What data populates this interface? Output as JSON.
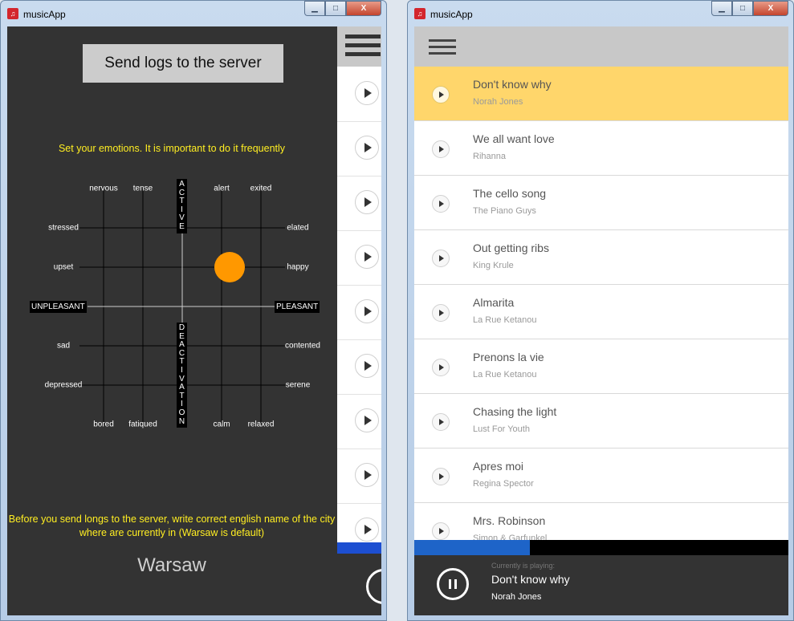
{
  "app_title": "musicApp",
  "window_buttons": {
    "minimize": "▁",
    "maximize": "□",
    "close": "X"
  },
  "emotion_panel": {
    "send_logs_label": "Send logs to the server",
    "instruction": "Set your emotions. It is important to do it frequently",
    "axis": {
      "active": "A\nC\nT\nI\nV\nE",
      "deactivation": "D\nE\nA\nC\nT\nI\nV\nA\nT\nI\nO\nN",
      "unpleasant": "UNPLEASANT",
      "pleasant": "PLEASANT"
    },
    "emotions": [
      "nervous",
      "tense",
      "alert",
      "exited",
      "stressed",
      "elated",
      "upset",
      "happy",
      "sad",
      "contented",
      "depressed",
      "serene",
      "bored",
      "fatiqued",
      "calm",
      "relaxed"
    ],
    "selected_emotion": "happy",
    "marker_color": "#ff9800",
    "city_note": "Before you send longs to the server, write correct english name of the city where are currently in (Warsaw is default)",
    "city_value": "Warsaw"
  },
  "playlist": {
    "songs": [
      {
        "title": "Don't know why",
        "artist": "Norah Jones",
        "active": true
      },
      {
        "title": "We all want love",
        "artist": "Rihanna"
      },
      {
        "title": "The cello song",
        "artist": "The Piano Guys"
      },
      {
        "title": "Out getting ribs",
        "artist": "King Krule"
      },
      {
        "title": "Almarita",
        "artist": "La Rue Ketanou"
      },
      {
        "title": "Prenons la vie",
        "artist": "La Rue Ketanou"
      },
      {
        "title": "Chasing the light",
        "artist": "Lust For Youth"
      },
      {
        "title": "Apres moi",
        "artist": "Regina Spector"
      },
      {
        "title": "Mrs. Robinson",
        "artist": "Simon & Garfunkel"
      }
    ],
    "active_color": "#ffd66b",
    "progress": 0.31
  },
  "now_playing": {
    "label": "Currently is playing:",
    "title": "Don't know why",
    "artist": "Norah Jones"
  }
}
